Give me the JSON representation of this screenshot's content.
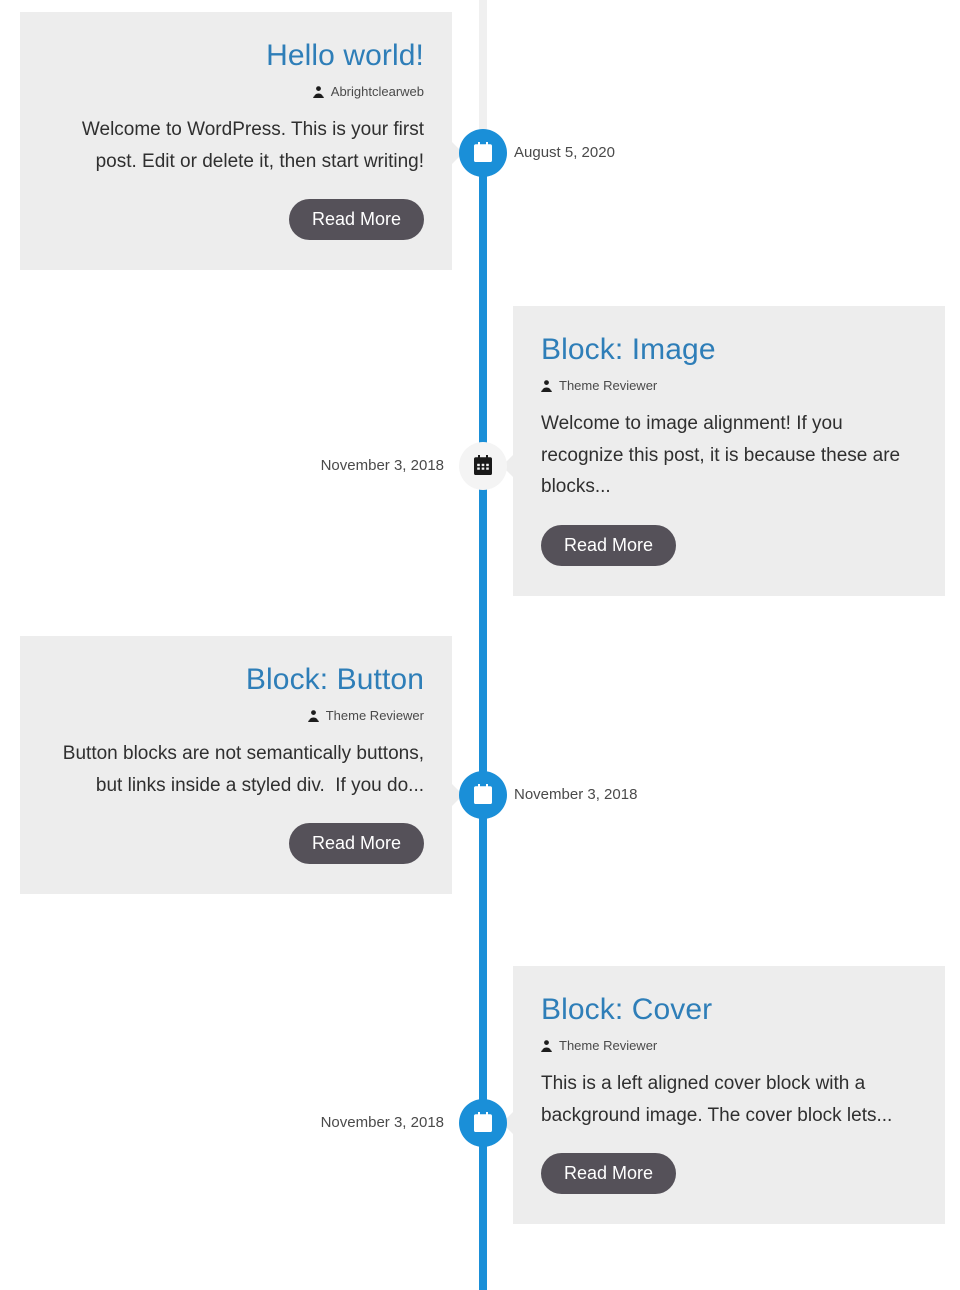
{
  "theme": {
    "accent_color": "#1a8fd8",
    "title_color": "#2e7eb8",
    "card_background": "#ededed",
    "button_color": "#555159",
    "rail_color": "#f0f0f0",
    "page_background": "#ffffff"
  },
  "icons": {
    "calendar": "calendar-icon",
    "author": "author-icon"
  },
  "entries": [
    {
      "side": "left",
      "title": "Hello world!",
      "author": "Abrightclearweb",
      "excerpt": "Welcome to WordPress. This is your first post. Edit or delete it, then start writing!",
      "button_label": "Read More",
      "date": "August 5, 2020",
      "marker_state": "active"
    },
    {
      "side": "right",
      "title": "Block: Image",
      "author": "Theme Reviewer",
      "excerpt": "Welcome to image alignment! If you recognize this post, it is because these are blocks...",
      "button_label": "Read More",
      "date": "November 3, 2018",
      "marker_state": "muted"
    },
    {
      "side": "left",
      "title": "Block: Button",
      "author": "Theme Reviewer",
      "excerpt": "Button blocks are not semantically buttons, but links inside a styled div.  If you do...",
      "button_label": "Read More",
      "date": "November 3, 2018",
      "marker_state": "active"
    },
    {
      "side": "right",
      "title": "Block: Cover",
      "author": "Theme Reviewer",
      "excerpt": "This is a left aligned cover block with a background image. The cover block lets...",
      "button_label": "Read More",
      "date": "November 3, 2018",
      "marker_state": "active"
    }
  ]
}
